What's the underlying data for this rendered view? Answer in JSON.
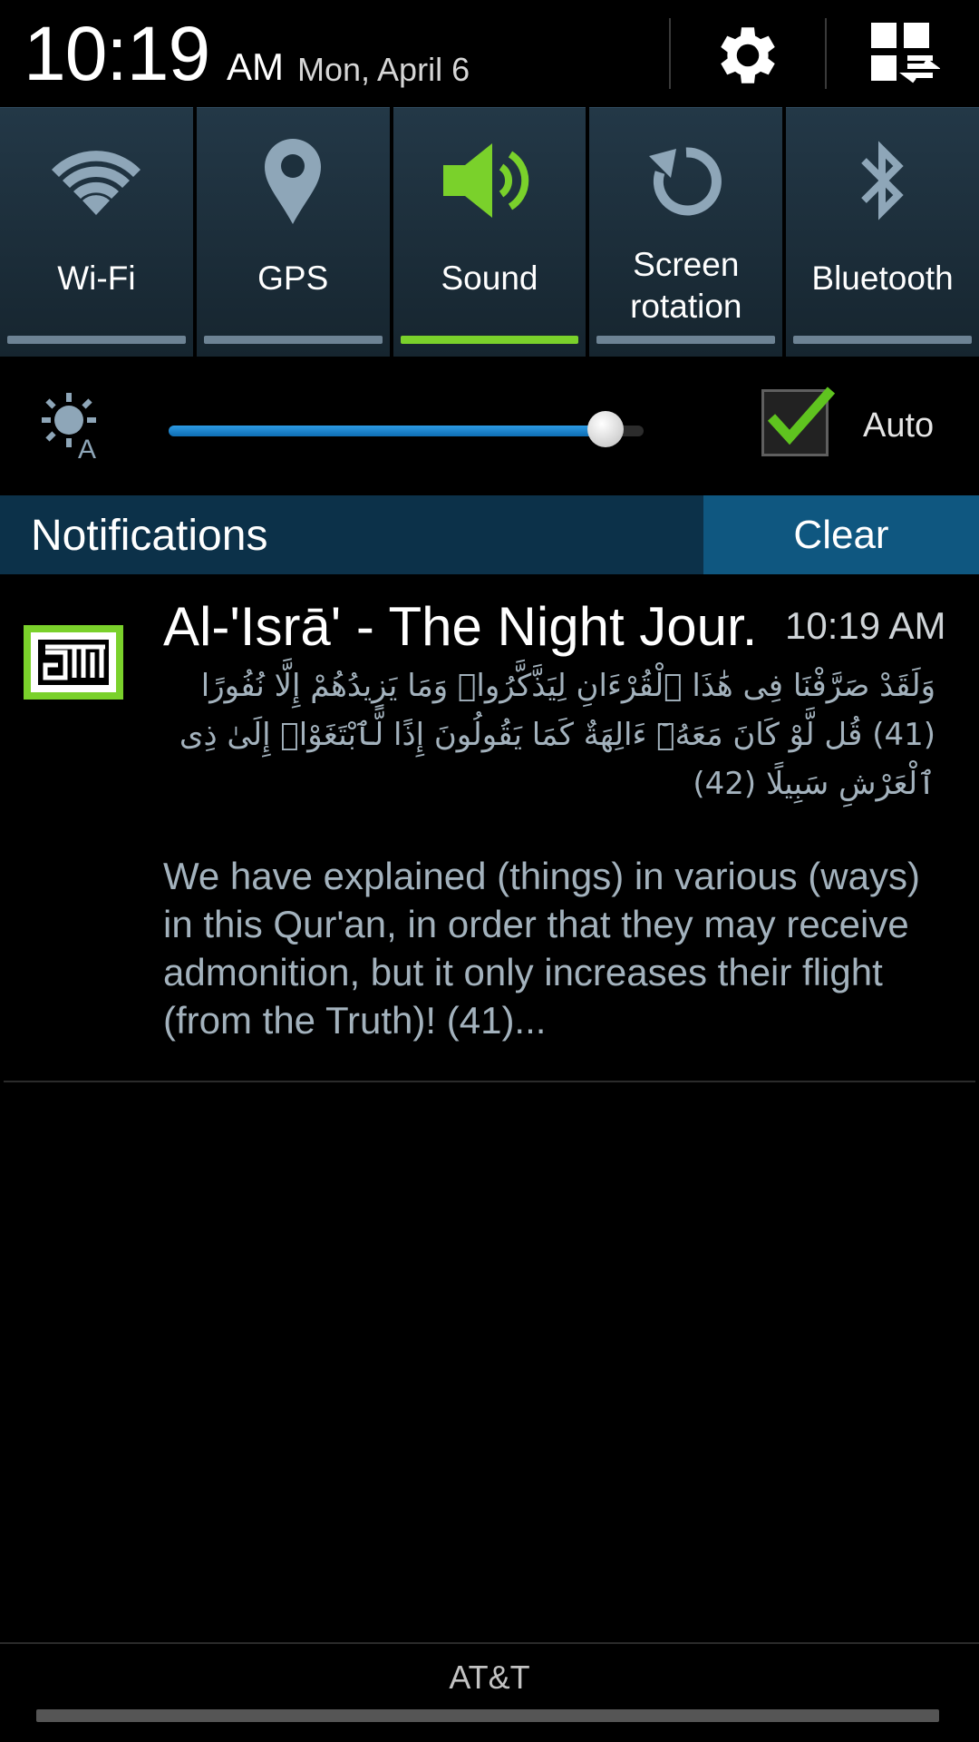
{
  "header": {
    "time": "10:19",
    "ampm": "AM",
    "date": "Mon, April 6"
  },
  "quick_toggles": [
    {
      "label": "Wi-Fi",
      "icon": "wifi-icon",
      "on": false
    },
    {
      "label": "GPS",
      "icon": "location-pin-icon",
      "on": false
    },
    {
      "label": "Sound",
      "icon": "speaker-icon",
      "on": true
    },
    {
      "label_line1": "Screen",
      "label_line2": "rotation",
      "icon": "rotation-icon",
      "on": false
    },
    {
      "label": "Bluetooth",
      "icon": "bluetooth-icon",
      "on": false
    }
  ],
  "brightness": {
    "level": 0.92,
    "auto_checked": true,
    "auto_label": "Auto"
  },
  "notifications": {
    "title": "Notifications",
    "clear_label": "Clear",
    "items": [
      {
        "title": "Al-'Isrā' - The Night Jour..",
        "time": "10:19 AM",
        "arabic": "وَلَقَدْ صَرَّفْنَا فِى هَٰذَا ٱلْقُرْءَانِ لِيَذَّكَّرُوا۟ وَمَا يَزِيدُهُمْ إِلَّا نُفُورًا (41) قُل لَّوْ كَانَ مَعَهُۥٓ ءَالِهَةٌ كَمَا يَقُولُونَ إِذًا لَّٱبْتَغَوْا۟ إِلَىٰ ذِى ٱلْعَرْشِ سَبِيلًا (42)",
        "english": "We have explained (things) in various (ways) in this Qur'an, in order that they may receive admonition, but it only increases their flight (from the Truth)! (41)..."
      }
    ]
  },
  "footer": {
    "carrier": "AT&T"
  },
  "colors": {
    "tile_on": "#7ad12b",
    "tile_off": "#6d8394",
    "notif_bar": "#0c3149",
    "clear_button": "#0f5780",
    "app_icon_green": "#7ad12b"
  }
}
